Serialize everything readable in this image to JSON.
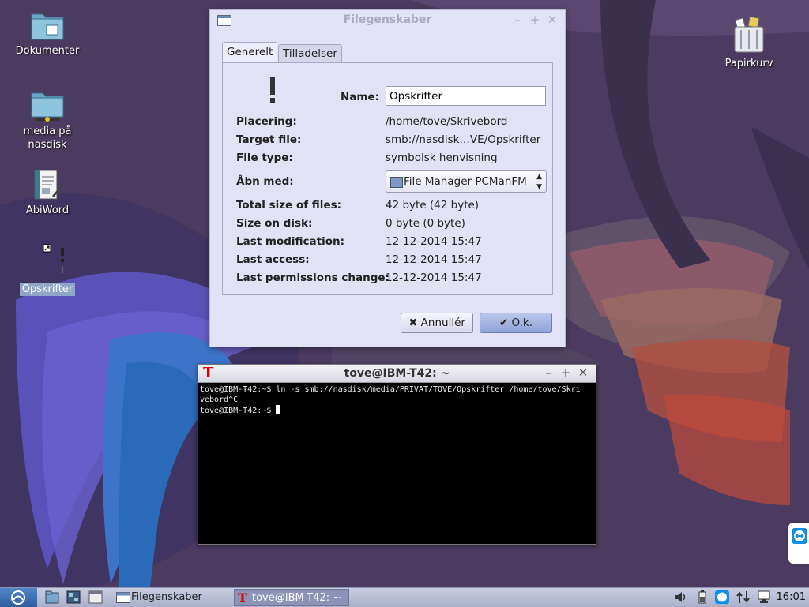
{
  "desktop": {
    "icons": [
      {
        "label": "Dokumenter"
      },
      {
        "label": "media på nasdisk"
      },
      {
        "label": "AbiWord"
      },
      {
        "label": "Opskrifter"
      },
      {
        "label": "Papirkurv"
      }
    ]
  },
  "dialog": {
    "title": "Filegenskaber",
    "tabs": [
      "Generelt",
      "Tilladelser"
    ],
    "name_label": "Name:",
    "name_value": "Opskrifter",
    "rows": [
      {
        "key": "Placering:",
        "value": "/home/tove/Skrivebord"
      },
      {
        "key": "Target file:",
        "value": "smb://nasdisk…VE/Opskrifter"
      },
      {
        "key": "File type:",
        "value": "symbolsk henvisning"
      },
      {
        "key": "Åbn med:",
        "value": "File Manager PCManFM"
      },
      {
        "key": "Total size of files:",
        "value": "42 byte (42 byte)"
      },
      {
        "key": "Size on disk:",
        "value": "0 byte (0 byte)"
      },
      {
        "key": "Last modification:",
        "value": "12-12-2014 15:47"
      },
      {
        "key": "Last access:",
        "value": "12-12-2014 15:47"
      },
      {
        "key": "Last permissions change:",
        "value": "12-12-2014 15:47"
      }
    ],
    "cancel_label": "✖ Annullér",
    "ok_label": "✔ O.k."
  },
  "terminal": {
    "title": "tove@IBM-T42: ~",
    "lines": [
      "tove@IBM-T42:~$ ln -s smb://nasdisk/media/PRIVAT/TOVE/Opskrifter /home/tove/Skri",
      "vebord^C",
      "tove@IBM-T42:~$ "
    ]
  },
  "taskbar": {
    "tasks": [
      "Filegenskaber",
      "tove@IBM-T42: ~"
    ],
    "clock": "16:01"
  },
  "colors": {
    "desktop_bg": "#4a3a5e",
    "dialog_bg": "#e2e2f6",
    "taskbar_bg": "#b3b8d2",
    "accent": "#8fa3d8"
  }
}
